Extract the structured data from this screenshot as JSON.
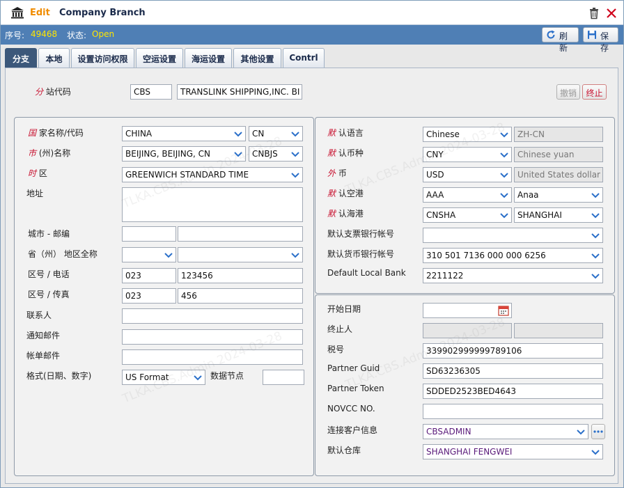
{
  "title": {
    "mode": "Edit",
    "text": "Company Branch"
  },
  "info": {
    "seq_label": "序号:",
    "seq_value": "49468",
    "status_label": "状态:",
    "status_value": "Open"
  },
  "toolbar": {
    "refresh": "刷新",
    "save": "保存"
  },
  "tabs": [
    "分支",
    "本地",
    "设置访问权限",
    "空运设置",
    "海运设置",
    "其他设置",
    "Contrl"
  ],
  "station": {
    "label_hl": "分",
    "label_rest": " 站代码",
    "code": "CBS",
    "name": "TRANSLINK SHIPPING,INC. BI",
    "cancel": "撤销",
    "stop": "终止"
  },
  "left": {
    "country": {
      "hl": "国",
      "rest": " 家名称/代码",
      "name": "CHINA",
      "code": "CN"
    },
    "city": {
      "hl": "市",
      "rest": " (州)名称",
      "name": "BEIJING, BEIJING, CN",
      "code": "CNBJS"
    },
    "timezone": {
      "hl": "时",
      "rest": " 区",
      "value": "GREENWICH STANDARD TIME"
    },
    "address": {
      "label": "地址",
      "value": ""
    },
    "city_zip": {
      "label": "城市 - 邮编",
      "city": "",
      "zip": ""
    },
    "province": {
      "label": "省（州） 地区全称",
      "code": "",
      "name": ""
    },
    "phone": {
      "label": "区号 / 电话",
      "area": "023",
      "number": "123456"
    },
    "fax": {
      "label": "区号 / 传真",
      "area": "023",
      "number": "456"
    },
    "contact": {
      "label": "联系人",
      "value": ""
    },
    "notify_email": {
      "label": "通知邮件",
      "value": ""
    },
    "bill_email": {
      "label": "帐单邮件",
      "value": ""
    },
    "format": {
      "label": "格式(日期、数字)",
      "value": "US Format",
      "decimal_label": "数据节点",
      "decimal_value": ""
    }
  },
  "right": {
    "language": {
      "hl": "默",
      "rest": " 认语言",
      "value": "Chinese",
      "code": "ZH-CN"
    },
    "currency": {
      "hl": "默",
      "rest": " 认币种",
      "value": "CNY",
      "name": "Chinese yuan"
    },
    "foreign": {
      "hl": "外",
      "rest": " 币",
      "value": "USD",
      "name": "United States dollar"
    },
    "airport": {
      "hl": "默",
      "rest": " 认空港",
      "code": "AAA",
      "name": "Anaa"
    },
    "seaport": {
      "hl": "默",
      "rest": " 认海港",
      "code": "CNSHA",
      "name": "SHANGHAI"
    },
    "check_bank": {
      "label": "默认支票银行帐号",
      "value": ""
    },
    "currency_bank": {
      "label": "默认货币银行帐号",
      "value": "310 501 7136 000 000 6256"
    },
    "local_bank": {
      "label": "Default Local Bank",
      "value": "2211122"
    },
    "start_date": {
      "label": "开始日期",
      "value": ""
    },
    "terminator": {
      "label": "终止人",
      "v1": "",
      "v2": ""
    },
    "tax": {
      "label": "税号",
      "value": "339902999999789106"
    },
    "guid": {
      "label": "Partner Guid",
      "value": "SD63236305"
    },
    "token": {
      "label": "Partner Token",
      "value": "SDDED2523BED4643"
    },
    "novcc": {
      "label": "NOVCC NO.",
      "value": ""
    },
    "customer": {
      "label": "连接客户信息",
      "value": "CBSADMIN"
    },
    "warehouse": {
      "label": "默认仓库",
      "value": "SHANGHAI FENGWEI"
    }
  },
  "watermark": "TLKA.CBS.Admin 2024-03-28",
  "colors": {
    "header_blue": "#4f7fb5",
    "active_tab": "#3c587a",
    "accent_orange": "#f08c00",
    "required_red": "#c8102e",
    "status_yellow": "#ffe600"
  }
}
